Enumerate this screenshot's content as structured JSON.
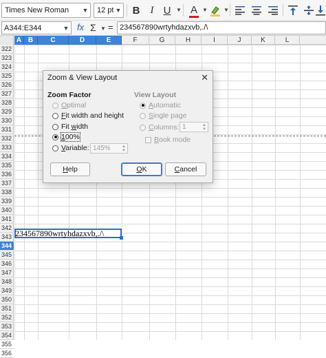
{
  "toolbar": {
    "font_name": "Times New Roman",
    "font_size": "12 pt",
    "bold_glyph": "B",
    "italic_glyph": "I",
    "underline_glyph": "U",
    "font_color_glyph": "A",
    "font_color": "#d21f1f",
    "highlight_color": "#f2c744"
  },
  "formula_bar": {
    "name_box": "A344:E344",
    "fx_label": "fx",
    "sum_label": "Σ",
    "equals_label": "=",
    "content": "234567890wrtyhdazxvb,./\\"
  },
  "grid": {
    "columns": [
      "A",
      "B",
      "C",
      "D",
      "E",
      "F",
      "G",
      "H",
      "I",
      "J",
      "K",
      "L"
    ],
    "selected_columns": [
      "A",
      "B",
      "C",
      "D",
      "E"
    ],
    "rows": [
      "322",
      "323",
      "324",
      "325",
      "326",
      "327",
      "328",
      "329",
      "330",
      "331",
      "332",
      "333",
      "334",
      "335",
      "336",
      "337",
      "338",
      "339",
      "340",
      "341",
      "342",
      "343",
      "344",
      "345",
      "346",
      "347",
      "348",
      "349",
      "350",
      "351",
      "352",
      "353",
      "354",
      "355",
      "356"
    ],
    "selected_row": "344",
    "cell_text": "234567890wrtyhdazxvb,./\\"
  },
  "dialog": {
    "title": "Zoom & View Layout",
    "close_glyph": "✕",
    "zoom_factor": {
      "heading": "Zoom Factor",
      "optimal": {
        "pre": "",
        "key": "O",
        "post": "ptimal"
      },
      "fit_width_height": {
        "pre": "",
        "key": "F",
        "post": "it width and height"
      },
      "fit_width": {
        "pre": "Fit ",
        "key": "w",
        "post": "idth"
      },
      "hundred": {
        "pre": "",
        "key": "1",
        "post": "00%"
      },
      "variable": {
        "pre": "",
        "key": "V",
        "post": "ariable:"
      },
      "variable_value": "145%"
    },
    "view_layout": {
      "heading": "View Layout",
      "automatic": {
        "pre": "",
        "key": "A",
        "post": "utomatic"
      },
      "single_page": {
        "pre": "",
        "key": "S",
        "post": "ingle page"
      },
      "columns": {
        "pre": "",
        "key": "C",
        "post": "olumns:"
      },
      "columns_value": "1",
      "book_mode": {
        "pre": "",
        "key": "B",
        "post": "ook mode"
      }
    },
    "buttons": {
      "help": {
        "pre": "",
        "key": "H",
        "post": "elp"
      },
      "ok": {
        "pre": "",
        "key": "O",
        "post": "K"
      },
      "cancel": {
        "pre": "",
        "key": "C",
        "post": "ancel"
      }
    }
  }
}
